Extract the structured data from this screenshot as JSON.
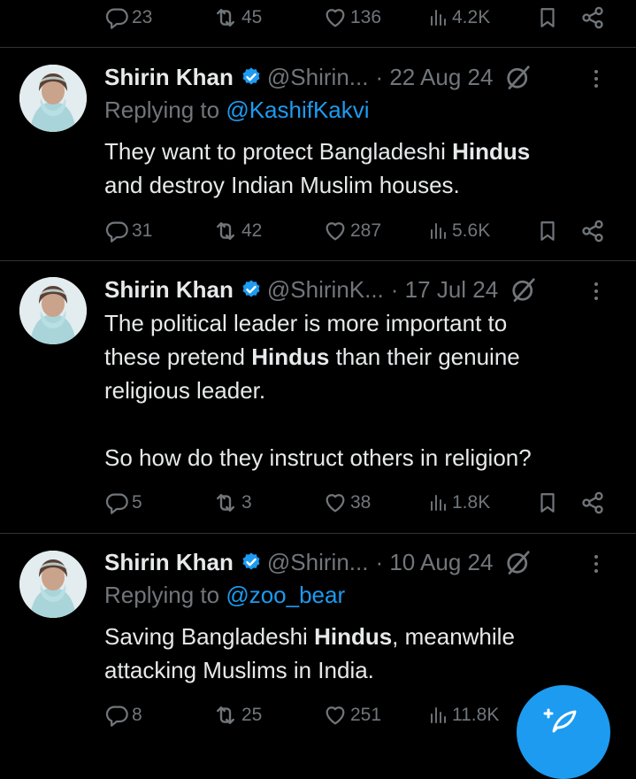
{
  "top_actions": {
    "replies": "23",
    "reposts": "45",
    "likes": "136",
    "views": "4.2K"
  },
  "tweets": [
    {
      "name": "Shirin Khan",
      "handle": "@Shirin...",
      "date": "· 22 Aug 24",
      "replying_prefix": "Replying to ",
      "replying_to": "@KashifKakvi",
      "text_1": "They want to protect Bangladeshi ",
      "bold_1": "Hindus",
      "text_2": "and destroy Indian Muslim houses.",
      "replies": "31",
      "reposts": "42",
      "likes": "287",
      "views": "5.6K"
    },
    {
      "name": "Shirin Khan",
      "handle": "@ShirinK...",
      "date": "· 17 Jul 24",
      "text_1": "The political leader is more important to",
      "text_2": "these pretend ",
      "bold_1": "Hindus",
      "text_3": " than their genuine",
      "text_4": "religious leader.",
      "text_5": "So how do they instruct others in religion?",
      "replies": "5",
      "reposts": "3",
      "likes": "38",
      "views": "1.8K"
    },
    {
      "name": "Shirin Khan",
      "handle": "@Shirin...",
      "date": "· 10 Aug 24",
      "replying_prefix": "Replying to ",
      "replying_to": "@zoo_bear",
      "text_1": "Saving Bangladeshi ",
      "bold_1": "Hindus",
      "text_2": ", meanwhile",
      "text_3": "attacking Muslims in India.",
      "replies": "8",
      "reposts": "25",
      "likes": "251",
      "views": "11.8K"
    }
  ],
  "icons": {
    "reply": "speech-bubble-icon",
    "repost": "repost-arrows-icon",
    "like": "heart-icon",
    "views": "bar-chart-icon",
    "bookmark": "bookmark-icon",
    "share": "share-icon",
    "verified": "verified-badge-icon",
    "grok": "grok-icon",
    "more": "more-options-icon",
    "compose": "compose-feather-icon"
  },
  "colors": {
    "background": "#000000",
    "text": "#e7e9ea",
    "muted": "#71767b",
    "accent": "#1d9bf0",
    "divider": "#2f3336"
  }
}
